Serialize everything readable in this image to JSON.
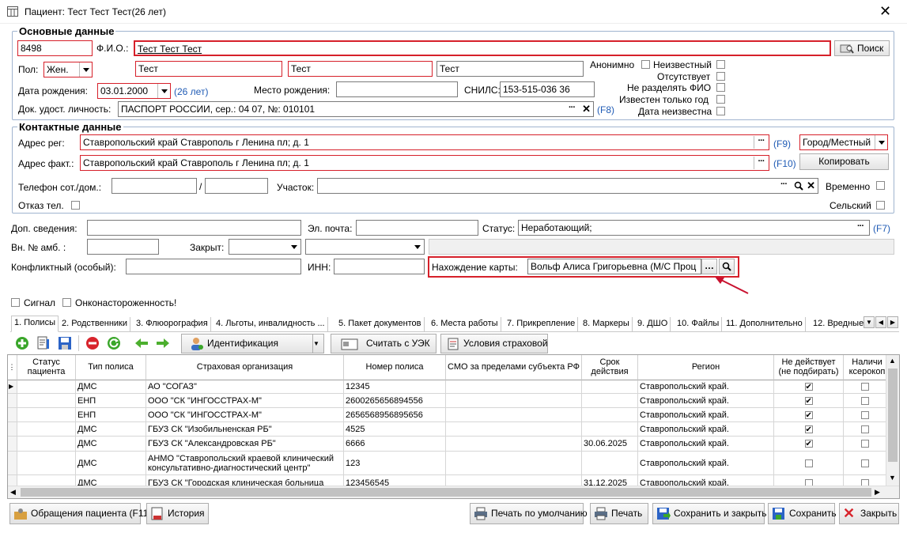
{
  "window": {
    "title": "Пациент: Тест Тест Тест(26 лет)"
  },
  "main": {
    "section_title": "Основные данные",
    "id_value": "8498",
    "fio_label": "Ф.И.О.:",
    "fio_value": "Тест Тест Тест",
    "search_label": "Поиск",
    "sex_label": "Пол:",
    "sex_value": "Жен.",
    "surname": "Тест",
    "name": "Тест",
    "patronymic": "Тест",
    "anonymous_label": "Анонимно",
    "unknown_label": "Неизвестный",
    "absent_label": "Отсутствует",
    "no_split_label": "Не разделять ФИО",
    "year_only_label": "Известен только год",
    "date_unknown_label": "Дата неизвестна",
    "birth_label": "Дата рождения:",
    "birth_value": "03.01.2000",
    "age_value": "(26 лет)",
    "birthplace_label": "Место рождения:",
    "birthplace_value": "",
    "snils_label": "СНИЛС:",
    "snils_value": "153-515-036 36",
    "doc_label": "Док. удост. личность:",
    "doc_value": "ПАСПОРТ РОССИИ, сер.: 04 07, №: 010101",
    "doc_hotkey": "(F8)"
  },
  "contacts": {
    "section_title": "Контактные данные",
    "addr_reg_label": "Адрес рег:",
    "addr_reg_value": "Ставропольский край Ставрополь г Ленина пл; д. 1",
    "addr_reg_hotkey": "(F9)",
    "locality_value": "Город/Местный",
    "addr_fact_label": "Адрес факт.:",
    "addr_fact_value": "Ставропольский край Ставрополь г Ленина пл; д. 1",
    "addr_fact_hotkey": "(F10)",
    "copy_label": "Копировать",
    "phone_label": "Телефон сот./дом.:",
    "phone_sep": "/",
    "district_label": "Участок:",
    "temporary_label": "Временно",
    "refuse_phone_label": "Отказ тел.",
    "rural_label": "Сельский"
  },
  "extra": {
    "info_label": "Доп. сведения:",
    "email_label": "Эл. почта:",
    "status_label": "Статус:",
    "status_value": "Неработающий;",
    "status_hotkey": "(F7)",
    "amb_label": "Вн. № амб. :",
    "closed_label": "Закрыт:",
    "conflict_label": "Конфликтный (особый):",
    "inn_label": "ИНН:",
    "card_label": "Нахождение карты:",
    "card_value": "Вольф Алиса Григорьевна (М/С Проц",
    "signal_label": "Сигнал",
    "onco_label": "Онконастороженность!"
  },
  "tabs": [
    "1. Полисы",
    "2. Родственники",
    "3. Флюорография",
    "4. Льготы, инвалидность ...",
    "5. Пакет документов",
    "6. Места работы",
    "7. Прикрепление",
    "8. Маркеры",
    "9. ДШО",
    "10. Файлы",
    "11. Дополнительно",
    "12. Вредные"
  ],
  "toolbar": {
    "identify_label": "Идентификация",
    "uek_label": "Считать с УЭК",
    "insurance_label": "Условия страховой"
  },
  "table": {
    "headers": [
      "Статус пациента",
      "Тип полиса",
      "Страховая организация",
      "Номер полиса",
      "СМО за пределами субъекта РФ",
      "Срок действия",
      "Регион",
      "Не действует (не подбирать)",
      "Наличи ксерокоп"
    ],
    "rows": [
      {
        "type": "ДМС",
        "org": "АО \"СОГАЗ\"",
        "number": "12345",
        "term": "",
        "region": "Ставропольский край.",
        "inactive": true
      },
      {
        "type": "ЕНП",
        "org": "ООО \"СК \"ИНГОССТРАХ-М\"",
        "number": "2600265656894556",
        "term": "",
        "region": "Ставропольский край.",
        "inactive": true
      },
      {
        "type": "ЕНП",
        "org": "ООО \"СК \"ИНГОССТРАХ-М\"",
        "number": "2656568956895656",
        "term": "",
        "region": "Ставропольский край.",
        "inactive": true
      },
      {
        "type": "ДМС",
        "org": "ГБУЗ СК \"Изобильненская РБ\"",
        "number": "4525",
        "term": "",
        "region": "Ставропольский край.",
        "inactive": true
      },
      {
        "type": "ДМС",
        "org": "ГБУЗ СК \"Александровская РБ\"",
        "number": "6666",
        "term": "30.06.2025",
        "region": "Ставропольский край.",
        "inactive": true
      },
      {
        "type": "ДМС",
        "org": "АНМО \"Ставропольский краевой клинический\nконсультативно-диагностический центр\"",
        "number": "123",
        "term": "",
        "region": "Ставропольский край.",
        "inactive": false
      },
      {
        "type": "ДМС",
        "org": "ГБУЗ  СК \"Городская клиническая  больница",
        "number": "123456545",
        "term": "31.12.2025",
        "region": "Ставропольский край.",
        "inactive": false
      }
    ]
  },
  "bottom": {
    "visits_label": "Обращения пациента (F11)",
    "history_label": "История",
    "print_default_label": "Печать по умолчанию",
    "print_label": "Печать",
    "save_close_label": "Сохранить и закрыть",
    "save_label": "Сохранить",
    "close_label": "Закрыть"
  }
}
